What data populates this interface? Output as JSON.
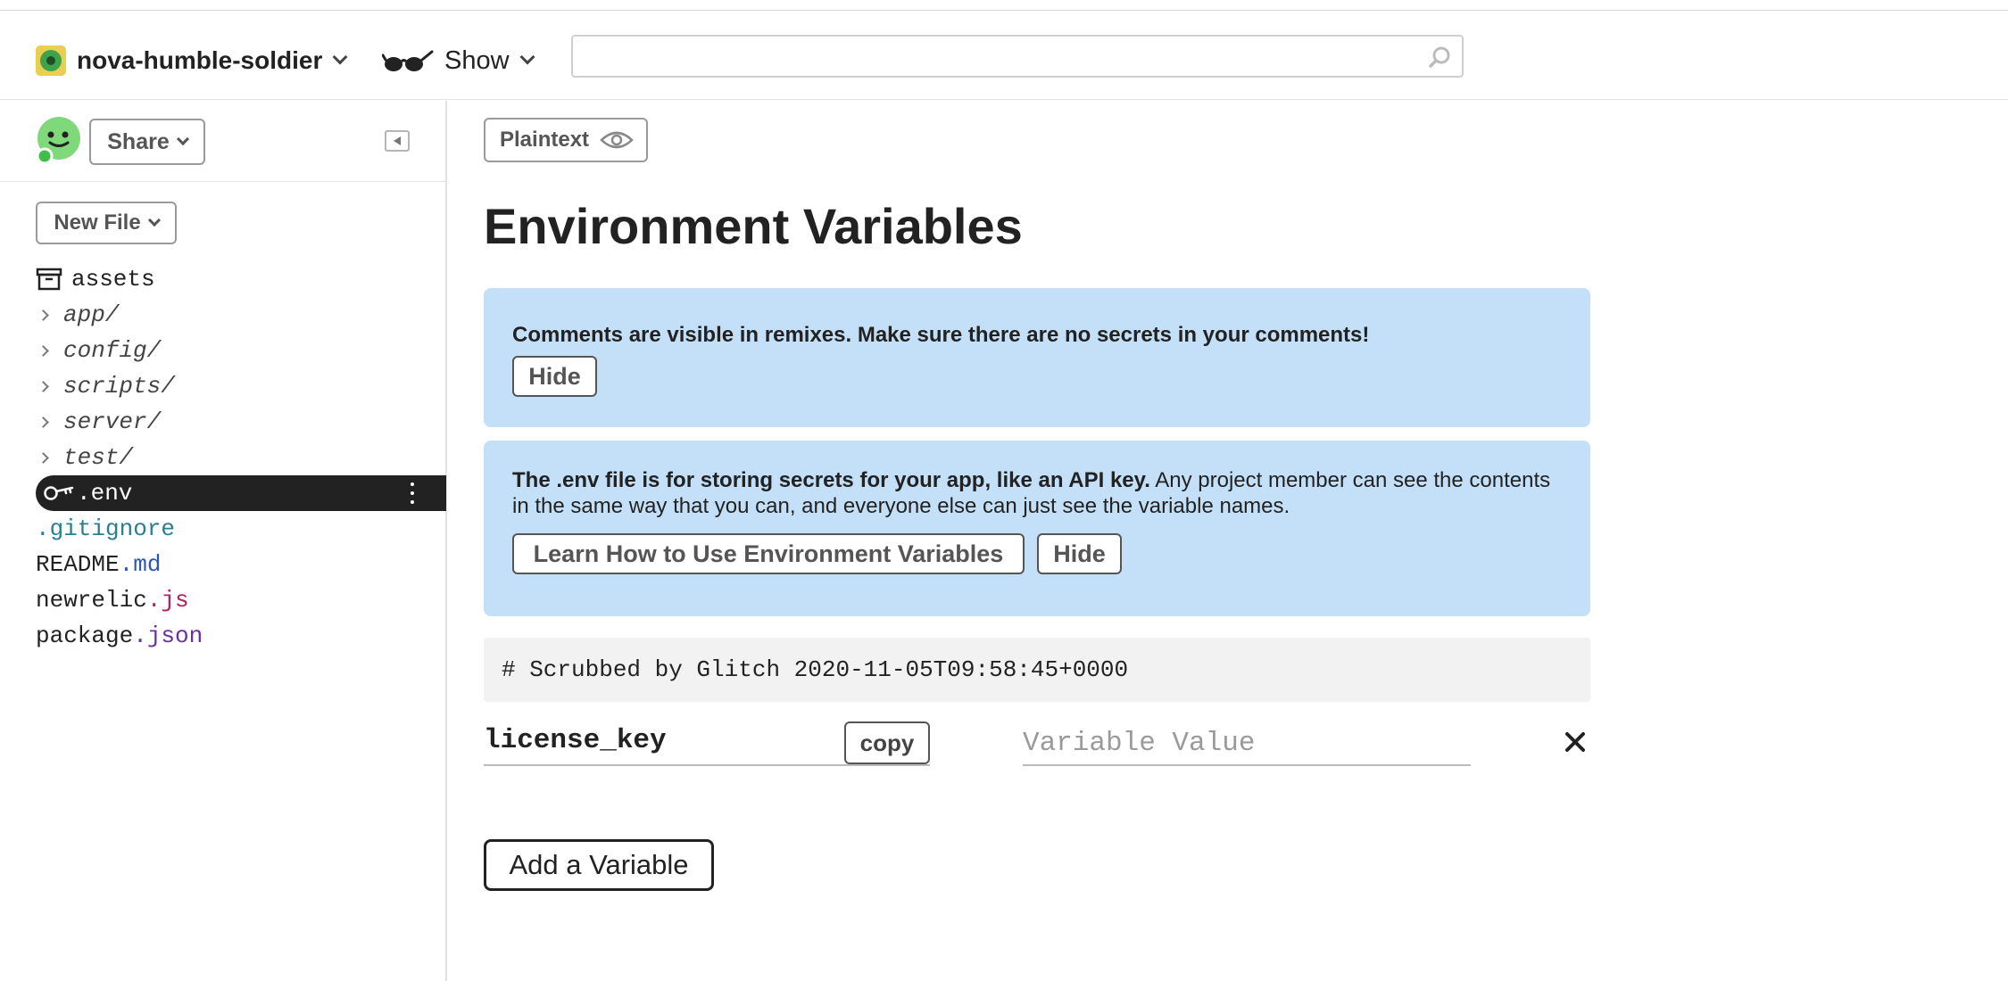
{
  "header": {
    "project_name": "nova-humble-soldier",
    "show_label": "Show",
    "search_value": "",
    "search_placeholder": ""
  },
  "sidebar": {
    "share_label": "Share",
    "new_file_label": "New File",
    "tree": [
      {
        "name": "assets",
        "kind": "assets"
      },
      {
        "name": "app/",
        "kind": "folder"
      },
      {
        "name": "config/",
        "kind": "folder"
      },
      {
        "name": "scripts/",
        "kind": "folder"
      },
      {
        "name": "server/",
        "kind": "folder"
      },
      {
        "name": "test/",
        "kind": "folder"
      },
      {
        "name": ".env",
        "kind": "file",
        "selected": true
      },
      {
        "name": ".gitignore",
        "kind": "file"
      },
      {
        "base": "README",
        "ext": ".md",
        "kind": "file"
      },
      {
        "base": "newrelic",
        "ext": ".js",
        "kind": "file"
      },
      {
        "base": "package",
        "ext": ".json",
        "kind": "file"
      }
    ]
  },
  "main": {
    "plaintext_label": "Plaintext",
    "title": "Environment Variables",
    "notice_comments": {
      "text": "Comments are visible in remixes. Make sure there are no secrets in your comments!",
      "hide_label": "Hide"
    },
    "notice_env": {
      "bold_text": "The .env file is for storing secrets for your app, like an API key.",
      "text": "Any project member can see the contents in the same way that you can, and everyone else can just see the variable names.",
      "learn_label": "Learn How to Use Environment Variables",
      "hide_label": "Hide"
    },
    "comment_line": "# Scrubbed by Glitch 2020-11-05T09:58:45+0000",
    "variables": [
      {
        "key": "license_key",
        "copy_label": "copy",
        "value": "",
        "value_placeholder": "Variable Value"
      }
    ],
    "add_variable_label": "Add a Variable"
  },
  "colors": {
    "notice_bg": "#c4e0f8",
    "selected_bg": "#222222",
    "avatar_green": "#7fd87a",
    "online_dot": "#3fbf4a",
    "ext_md": "#2f56b5",
    "ext_js": "#b0245a",
    "ext_json": "#6a2fa0",
    "gitignore": "#2a7f8f"
  }
}
